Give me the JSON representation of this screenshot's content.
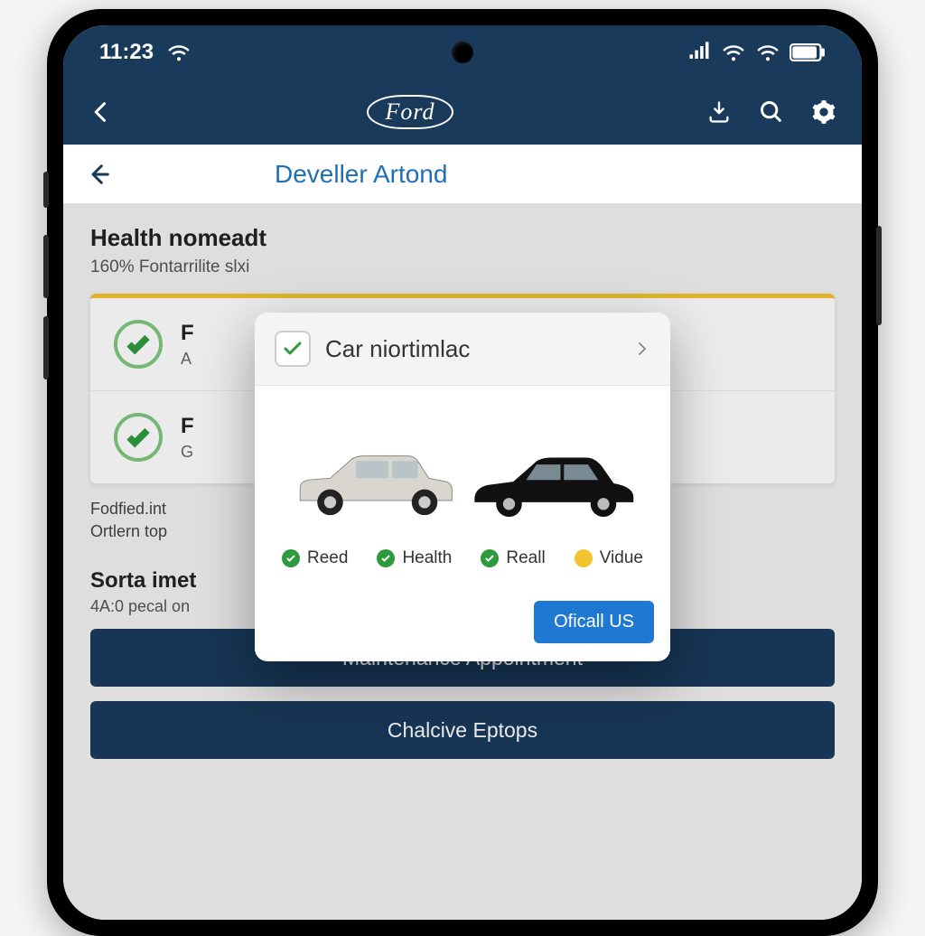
{
  "status": {
    "time": "11:23"
  },
  "nav": {
    "logo_text": "Ford"
  },
  "subheader": {
    "title": "Develler Artond"
  },
  "health": {
    "title": "Health nomeadt",
    "subtitle": "160% Fontarrilite slxi",
    "rows": [
      {
        "line1": "F",
        "line2": "A"
      },
      {
        "line1": "F",
        "line2": "G"
      }
    ],
    "footnote_line1": "Fodfied.int",
    "footnote_line2": "Ortlern top"
  },
  "section2": {
    "title": "Sorta imet",
    "subtitle": "4A:0 pecal on"
  },
  "buttons": {
    "maintenance": "Maintenance Appointment",
    "chalcive": "Chalcive Eptops"
  },
  "modal": {
    "title": "Car niortimlac",
    "statuses": [
      "Reed",
      "Health",
      "Reall",
      "Vidue"
    ],
    "cta": "Oficall US"
  }
}
